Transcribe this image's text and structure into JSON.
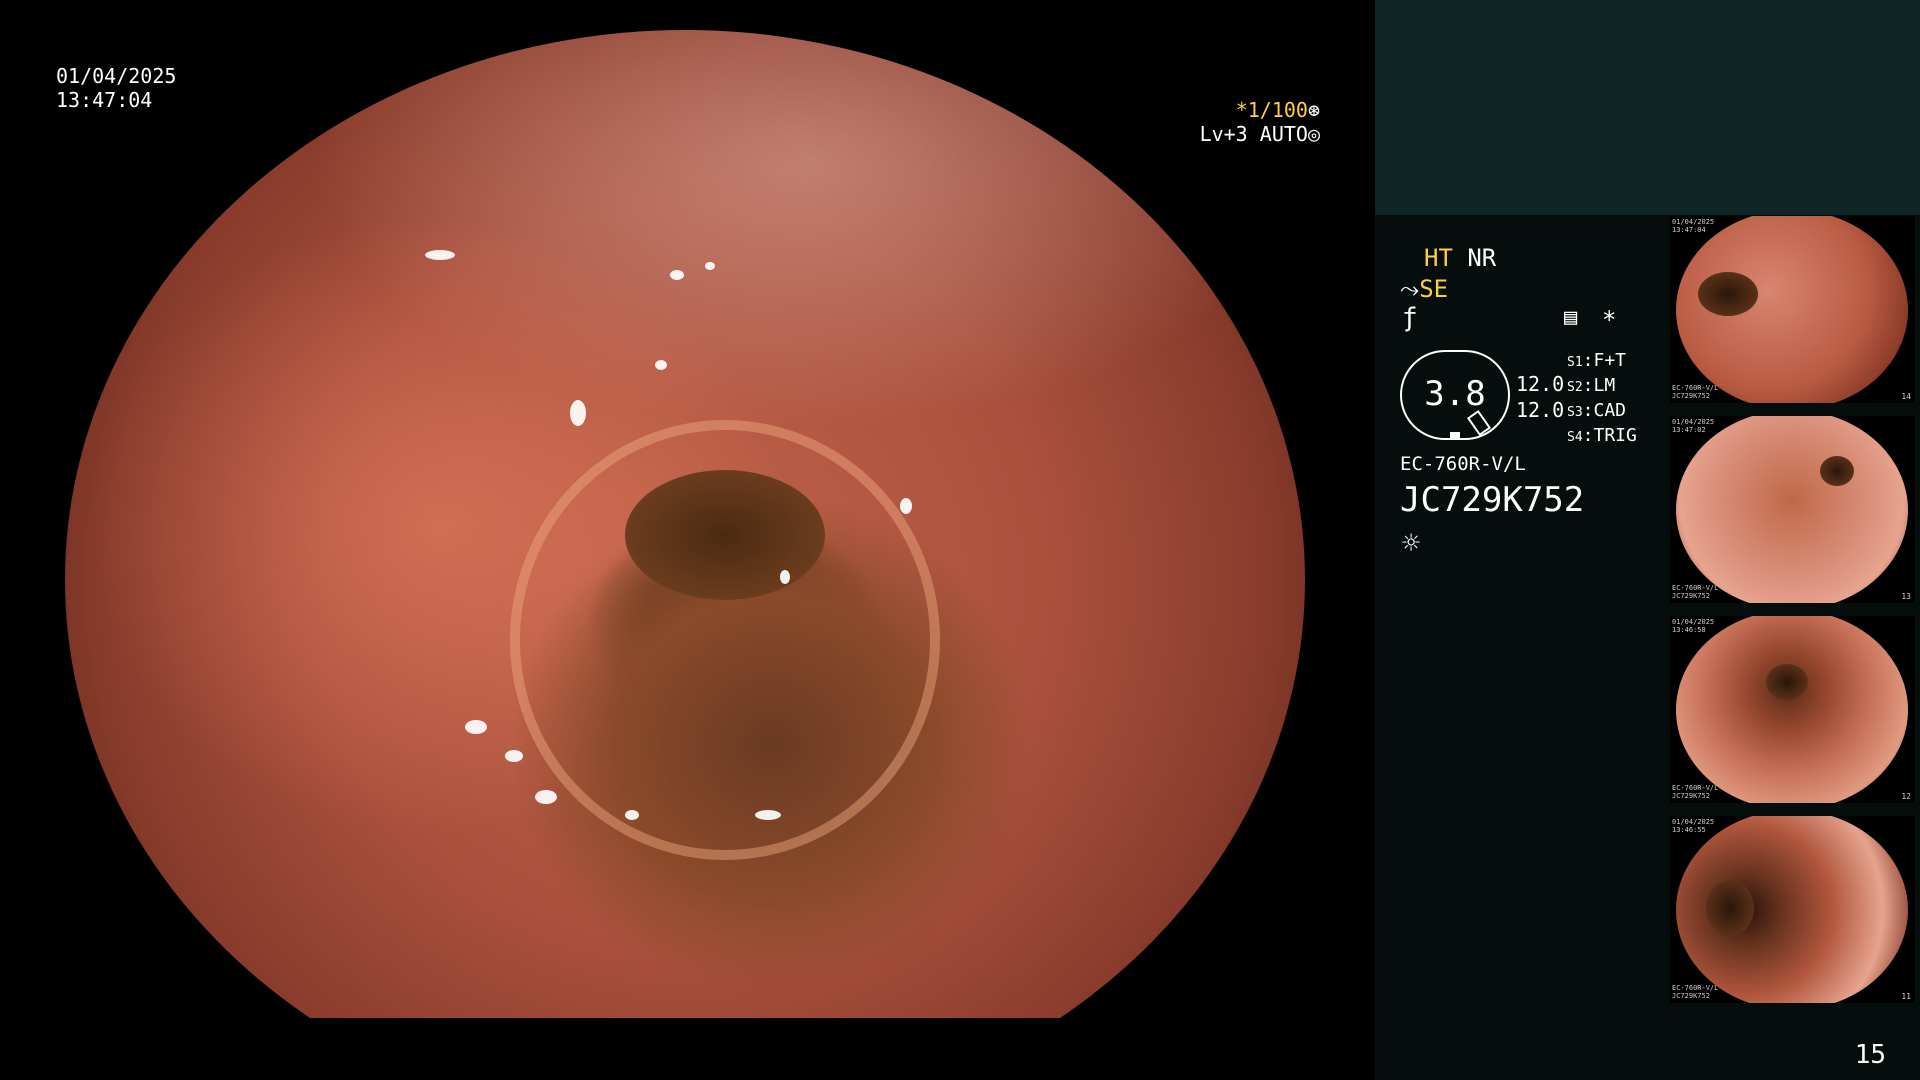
{
  "overlay": {
    "date": "01/04/2025",
    "time": "13:47:04",
    "shutter_prefix": "*",
    "shutter": "1/100",
    "shutter_icon": "aperture-icon",
    "level": "Lv+3",
    "mode": "AUTO",
    "mode_icon": "auto-iris-icon"
  },
  "panel": {
    "ht": "HT",
    "nr": "NR",
    "se": "SE",
    "se_icon": "structure-enhance-icon",
    "filter_icon": "filter-icon",
    "memory_icon": "memory-card-icon",
    "star": "*",
    "gauge_value": "3.8",
    "gauge_line1": "12.0",
    "gauge_line2": "12.0",
    "switches": [
      {
        "key": "S1",
        "value": "F+T"
      },
      {
        "key": "S2",
        "value": "LM"
      },
      {
        "key": "S3",
        "value": "CAD"
      },
      {
        "key": "S4",
        "value": "TRIG"
      }
    ],
    "scope_model": "EC-760R-V/L",
    "scope_serial": "JC729K752",
    "light_icon": "light-sun-icon",
    "page_number": "15"
  },
  "thumbnails": [
    {
      "text": "01/04/2025\n13:47:04",
      "serial": "EC-760R-V/L\nJC729K752",
      "num": "14"
    },
    {
      "text": "01/04/2025\n13:47:02",
      "serial": "EC-760R-V/L\nJC729K752",
      "num": "13"
    },
    {
      "text": "01/04/2025\n13:46:58",
      "serial": "EC-760R-V/L\nJC729K752",
      "num": "12"
    },
    {
      "text": "01/04/2025\n13:46:55",
      "serial": "EC-760R-V/L\nJC729K752",
      "num": "11"
    }
  ],
  "colors": {
    "accent": "#ffcf3f",
    "panel_top": "#0f2626",
    "panel_bottom": "#050d0d",
    "mucosa": "#c0634a"
  }
}
